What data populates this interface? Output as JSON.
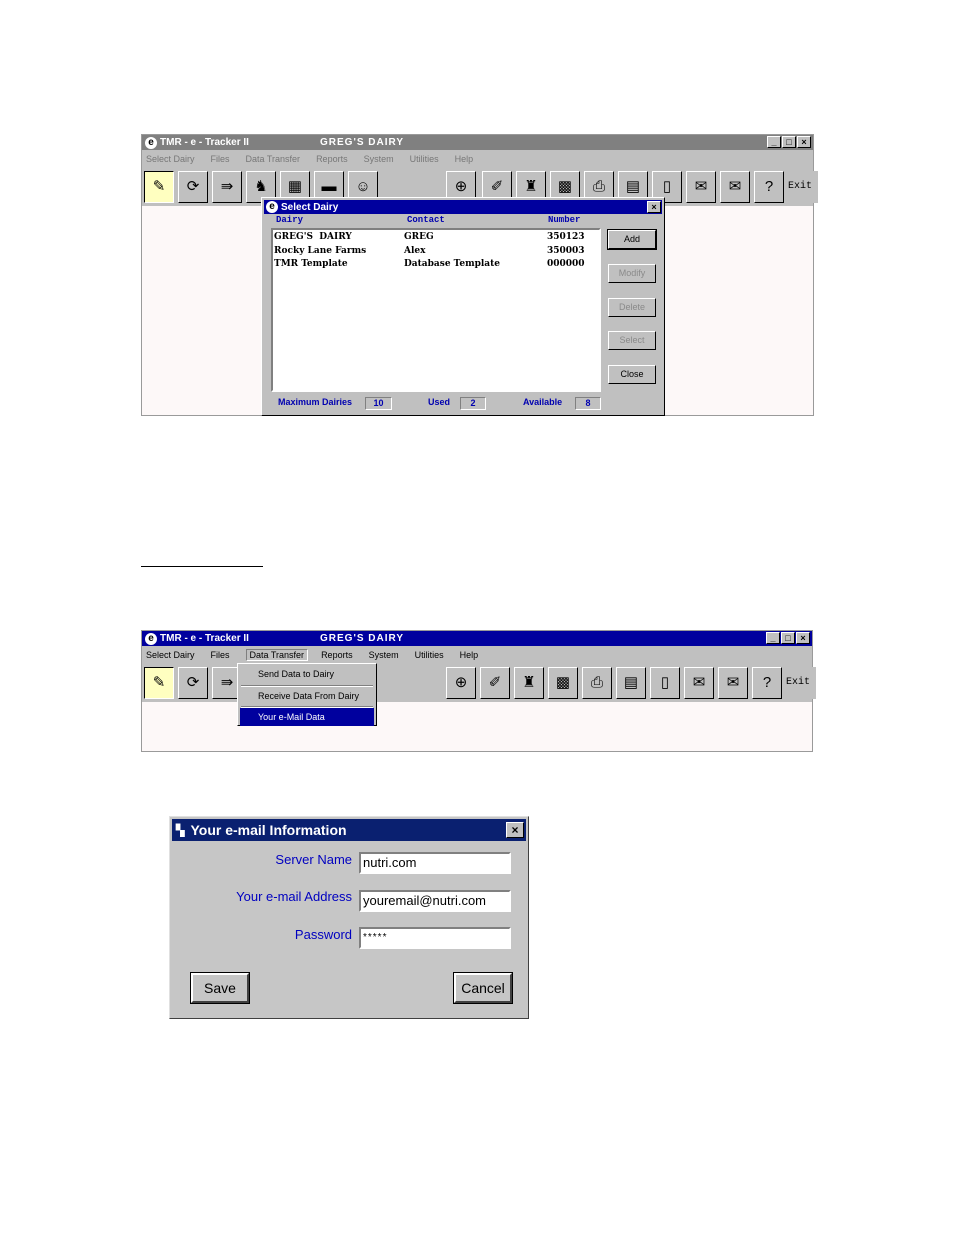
{
  "app": {
    "title": "TMR - e - Tracker II",
    "dairy_name": "GREG'S  DAIRY",
    "window_buttons": [
      "_",
      "□",
      "×"
    ]
  },
  "menu": [
    "Select Dairy",
    "Files",
    "Data Transfer",
    "Reports",
    "System",
    "Utilities",
    "Help"
  ],
  "toolbar": {
    "exit_label": "Exit",
    "icons": [
      "ration-icon",
      "feed-mix-icon",
      "transfer-icon",
      "cow-icon",
      "spreadsheet-icon",
      "truck-icon",
      "person-icon",
      "magnify-icon",
      "feed-add-icon",
      "bottles-icon",
      "calculator-icon",
      "printer-icon",
      "report-icon",
      "docs-icon",
      "email-send-icon",
      "email-receive-icon",
      "help-icon"
    ]
  },
  "select_dairy_dialog": {
    "title": "Select Dairy",
    "columns": [
      "Dairy",
      "Contact",
      "Number"
    ],
    "rows": [
      {
        "dairy": "GREG'S  DAIRY",
        "contact": "GREG",
        "number": "350123"
      },
      {
        "dairy": "Rocky Lane Farms",
        "contact": "Alex",
        "number": "350003"
      },
      {
        "dairy": "TMR Template",
        "contact": "Database Template",
        "number": "000000"
      }
    ],
    "buttons": {
      "add": "Add",
      "modify": "Modify",
      "delete": "Delete",
      "select": "Select",
      "close": "Close"
    },
    "footer": {
      "max_label": "Maximum Dairies",
      "max_value": "10",
      "used_label": "Used",
      "used_value": "2",
      "available_label": "Available",
      "available_value": "8"
    }
  },
  "data_transfer_menu": {
    "items": [
      "Send Data to Dairy",
      "Receive Data From Dairy",
      "Your e-Mail Data"
    ],
    "selected_index": 2
  },
  "email_dialog": {
    "title": "Your e-mail Information",
    "server_label": "Server Name",
    "server_value": "nutri.com",
    "email_label": "Your e-mail Address",
    "email_value": "youremail@nutri.com",
    "password_label": "Password",
    "password_value": "*****",
    "save_label": "Save",
    "cancel_label": "Cancel"
  }
}
